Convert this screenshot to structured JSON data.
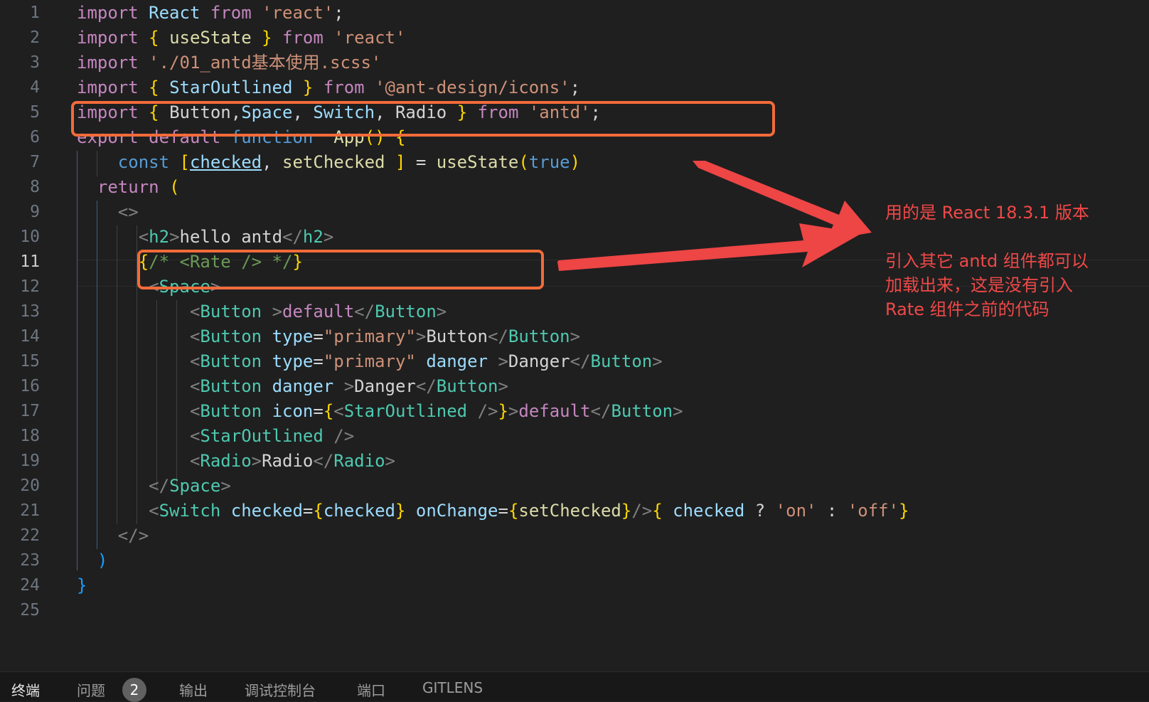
{
  "editor": {
    "active_line": "11",
    "lines": [
      {
        "n": "1",
        "code": "import React from 'react';"
      },
      {
        "n": "2",
        "code": "import { useState } from 'react'"
      },
      {
        "n": "3",
        "code": "import './01_antd基本使用.scss'"
      },
      {
        "n": "4",
        "code": "import { StarOutlined } from '@ant-design/icons';"
      },
      {
        "n": "5",
        "code": "import { Button,Space, Switch, Radio } from 'antd';"
      },
      {
        "n": "6",
        "code": "export default function  App() {"
      },
      {
        "n": "7",
        "code": "    const [checked, setChecked ] = useState(true)"
      },
      {
        "n": "8",
        "code": "  return ("
      },
      {
        "n": "9",
        "code": "    <>"
      },
      {
        "n": "10",
        "code": "      <h2>hello antd</h2>"
      },
      {
        "n": "11",
        "code": "      {/* <Rate /> */}"
      },
      {
        "n": "12",
        "code": "       <Space>"
      },
      {
        "n": "13",
        "code": "           <Button >default</Button>"
      },
      {
        "n": "14",
        "code": "           <Button type=\"primary\">Button</Button>"
      },
      {
        "n": "15",
        "code": "           <Button type=\"primary\" danger >Danger</Button>"
      },
      {
        "n": "16",
        "code": "           <Button danger >Danger</Button>"
      },
      {
        "n": "17",
        "code": "           <Button icon={<StarOutlined />}>default</Button>"
      },
      {
        "n": "18",
        "code": "           <StarOutlined />"
      },
      {
        "n": "19",
        "code": "           <Radio>Radio</Radio>"
      },
      {
        "n": "20",
        "code": "       </Space>"
      },
      {
        "n": "21",
        "code": "       <Switch checked={checked} onChange={setChecked}/>{ checked ? 'on' : 'off'}"
      },
      {
        "n": "22",
        "code": "    </>"
      },
      {
        "n": "23",
        "code": "  )"
      },
      {
        "n": "24",
        "code": "}"
      },
      {
        "n": "25",
        "code": ""
      }
    ]
  },
  "annotations": {
    "note_version": "用的是 React 18.3.1 版本",
    "note_body": [
      "引入其它 antd 组件都可以",
      "加载出来，这是没有引入",
      "Rate 组件之前的代码"
    ],
    "colors": {
      "annotation": "#f04848",
      "box": "#f26b3a"
    }
  },
  "bottom_panel": {
    "tabs": [
      "终端",
      "问题",
      "输出",
      "调试控制台",
      "端口",
      "GITLENS"
    ],
    "active_tab": "终端",
    "problems_badge": "2"
  }
}
